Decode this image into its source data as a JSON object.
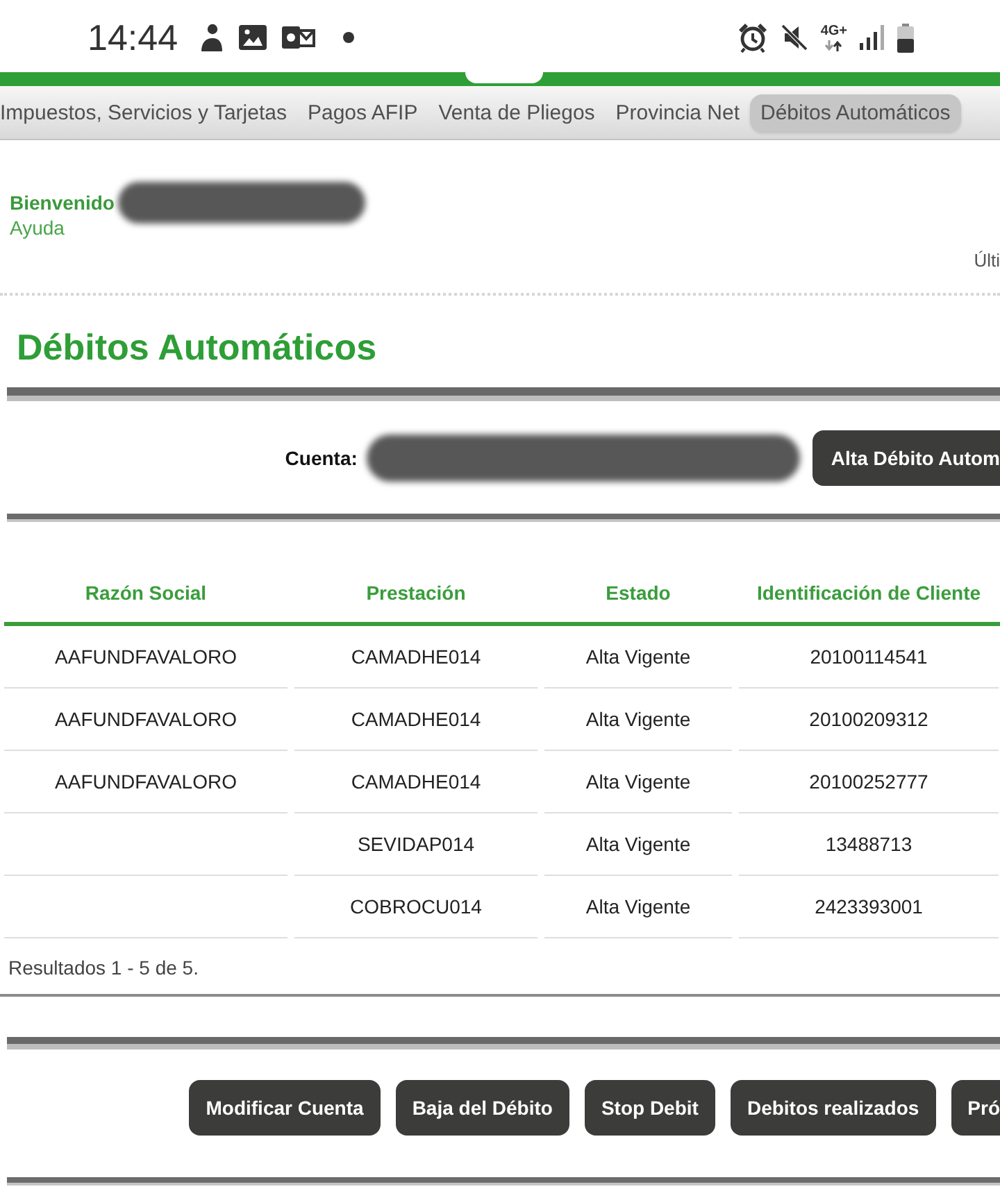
{
  "status_bar": {
    "time": "14:44",
    "network": "4G+"
  },
  "nav": {
    "items": [
      {
        "label": "Impuestos, Servicios y Tarjetas",
        "selected": false
      },
      {
        "label": "Pagos AFIP",
        "selected": false
      },
      {
        "label": "Venta de Pliegos",
        "selected": false
      },
      {
        "label": "Provincia Net",
        "selected": false
      },
      {
        "label": "Débitos Automáticos",
        "selected": true
      }
    ]
  },
  "header": {
    "welcome": "Bienvenido",
    "help": "Ayuda",
    "last_access": "Últi"
  },
  "page_title": "Débitos Automáticos",
  "account": {
    "label": "Cuenta:",
    "button": "Alta Débito Autom"
  },
  "table": {
    "columns": [
      "Razón Social",
      "Prestación",
      "Estado",
      "Identificación de Cliente"
    ],
    "rows": [
      {
        "razon_social": "AAFUNDFAVALORO",
        "prestacion": "CAMADHE014",
        "estado": "Alta Vigente",
        "identificacion_cliente": "20100114541"
      },
      {
        "razon_social": "AAFUNDFAVALORO",
        "prestacion": "CAMADHE014",
        "estado": "Alta Vigente",
        "identificacion_cliente": "20100209312"
      },
      {
        "razon_social": "AAFUNDFAVALORO",
        "prestacion": "CAMADHE014",
        "estado": "Alta Vigente",
        "identificacion_cliente": "20100252777"
      },
      {
        "prestacion": "SEVIDAP014",
        "estado": "Alta Vigente",
        "identificacion_cliente": "13488713"
      },
      {
        "prestacion": "COBROCU014",
        "estado": "Alta Vigente",
        "identificacion_cliente": "2423393001"
      }
    ],
    "results": "Resultados 1 - 5 de 5."
  },
  "actions": [
    "Modificar Cuenta",
    "Baja del Débito",
    "Stop Debit",
    "Debitos realizados",
    "Pró"
  ]
}
